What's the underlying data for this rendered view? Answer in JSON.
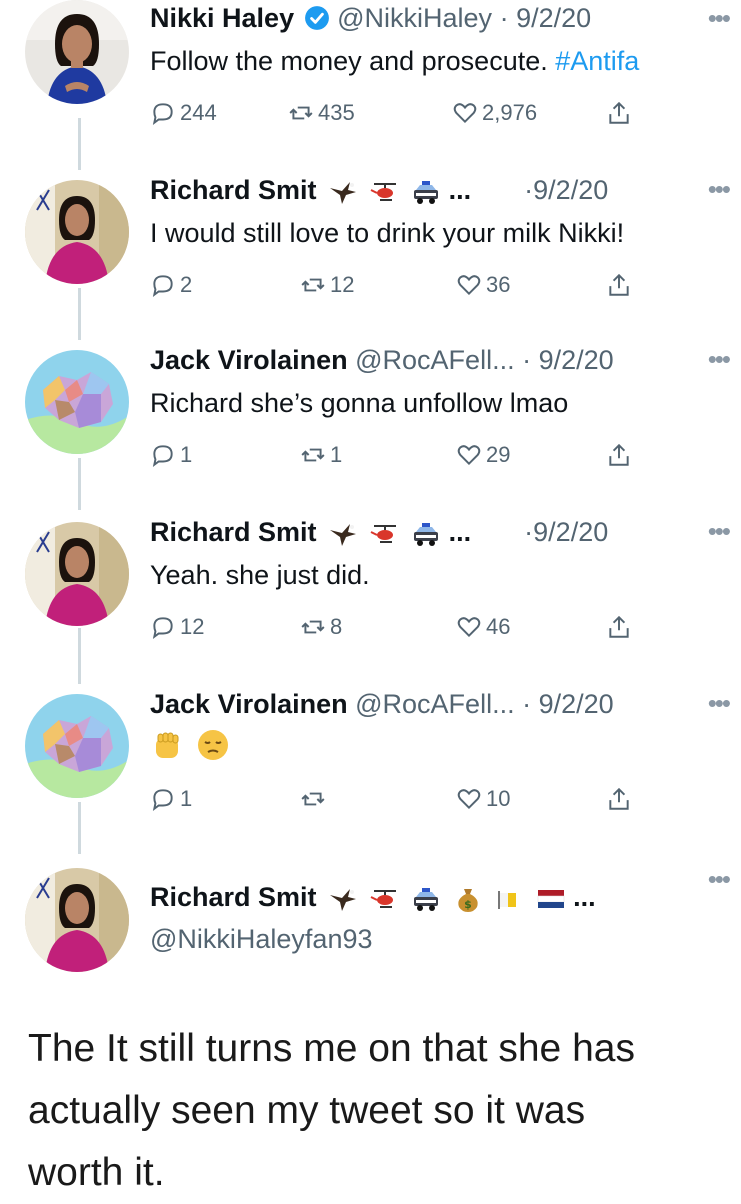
{
  "tweets": [
    {
      "name": "Nikki Haley",
      "verified": true,
      "handle": "@NikkiHaley",
      "date": "9/2/20",
      "text": "Follow the money and prosecute. ",
      "hashtag": "#Antifa",
      "replies": "244",
      "retweets": "435",
      "likes": "2,976",
      "avatar": "nikki-haley-portrait",
      "emojis": []
    },
    {
      "name": "Richard Smit",
      "handle": "",
      "truncation": "...",
      "date": "9/2/20",
      "text": "I would still love to drink your milk Nikki!",
      "replies": "2",
      "retweets": "12",
      "likes": "36",
      "avatar": "nikki-pink-dress-portrait",
      "emojis": [
        "eagle-icon",
        "helicopter-icon",
        "police-car-icon"
      ]
    },
    {
      "name": "Jack Virolainen",
      "handle": "@RocAFell...",
      "date": "9/2/20",
      "text": "Richard she’s gonna unfollow lmao",
      "replies": "1",
      "retweets": "1",
      "likes": "29",
      "avatar": "map-avatar",
      "emojis": []
    },
    {
      "name": "Richard Smit",
      "handle": "",
      "truncation": "...",
      "date": "9/2/20",
      "text": "Yeah. she just did.",
      "replies": "12",
      "retweets": "8",
      "likes": "46",
      "avatar": "nikki-pink-dress-portrait",
      "emojis": [
        "eagle-icon",
        "helicopter-icon",
        "police-car-icon"
      ]
    },
    {
      "name": "Jack Virolainen",
      "handle": "@RocAFell...",
      "date": "9/2/20",
      "text": "",
      "text_emojis": [
        "raised-fist-icon",
        "pensive-face-icon"
      ],
      "replies": "1",
      "retweets": "",
      "likes": "10",
      "avatar": "map-avatar",
      "emojis": []
    },
    {
      "name": "Richard Smit",
      "handle": "@NikkiHaleyfan93",
      "truncation": "...",
      "date": "",
      "text": "",
      "avatar": "nikki-pink-dress-portrait",
      "emojis": [
        "eagle-icon",
        "helicopter-icon",
        "police-car-icon",
        "money-bag-icon",
        "flag-icon",
        "netherlands-flag-icon"
      ]
    }
  ],
  "caption": {
    "lines": [
      "The It still turns me on that she has",
      "actually seen my tweet so it was",
      "worth it."
    ]
  },
  "colors": {
    "link": "#1d9bf0",
    "muted": "#536471",
    "verified": "#1d9bf0",
    "thread_line": "#cfd9de"
  }
}
